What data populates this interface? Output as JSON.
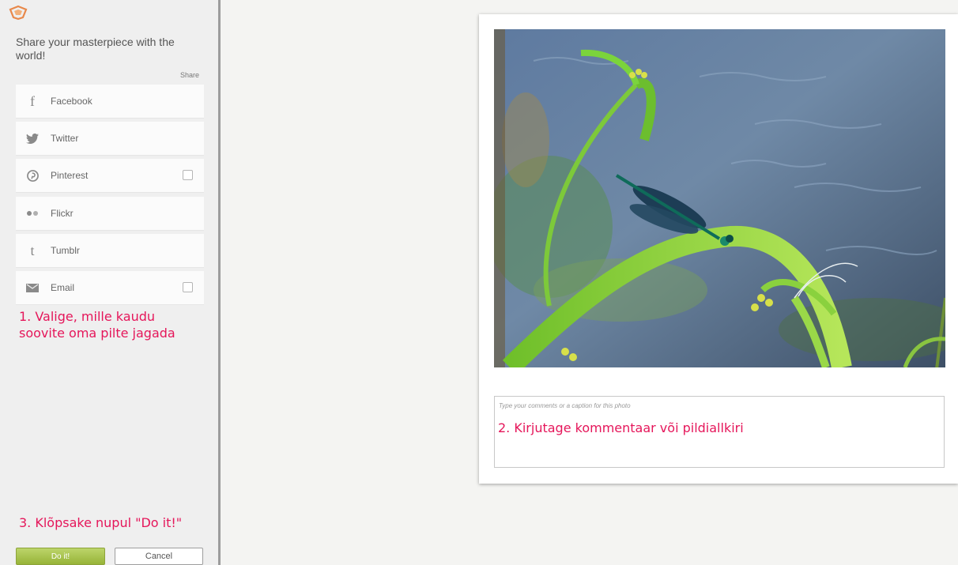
{
  "sidebar": {
    "heading": "Share your masterpiece with the world!",
    "share_column_label": "Share",
    "items": [
      {
        "label": "Facebook",
        "icon": "facebook-icon"
      },
      {
        "label": "Twitter",
        "icon": "twitter-icon"
      },
      {
        "label": "Pinterest",
        "icon": "pinterest-icon",
        "checkbox": true
      },
      {
        "label": "Flickr",
        "icon": "flickr-icon"
      },
      {
        "label": "Tumblr",
        "icon": "tumblr-icon"
      },
      {
        "label": "Email",
        "icon": "email-icon",
        "checkbox": true
      }
    ],
    "annotation_1": [
      "1. Valige, mille kaudu",
      "soovite oma pilte jagada"
    ],
    "annotation_3": "3. Klõpsake nupul \"Do it!\"",
    "do_it_label": "Do it!",
    "cancel_label": "Cancel"
  },
  "main": {
    "caption_placeholder": "Type your comments or a caption for this photo",
    "annotation_2": "2. Kirjutage kommentaar või pildiallkiri"
  },
  "colors": {
    "annotation": "#e5165a",
    "do_it_button": "#a9c04a",
    "logo": "#e8884a"
  }
}
